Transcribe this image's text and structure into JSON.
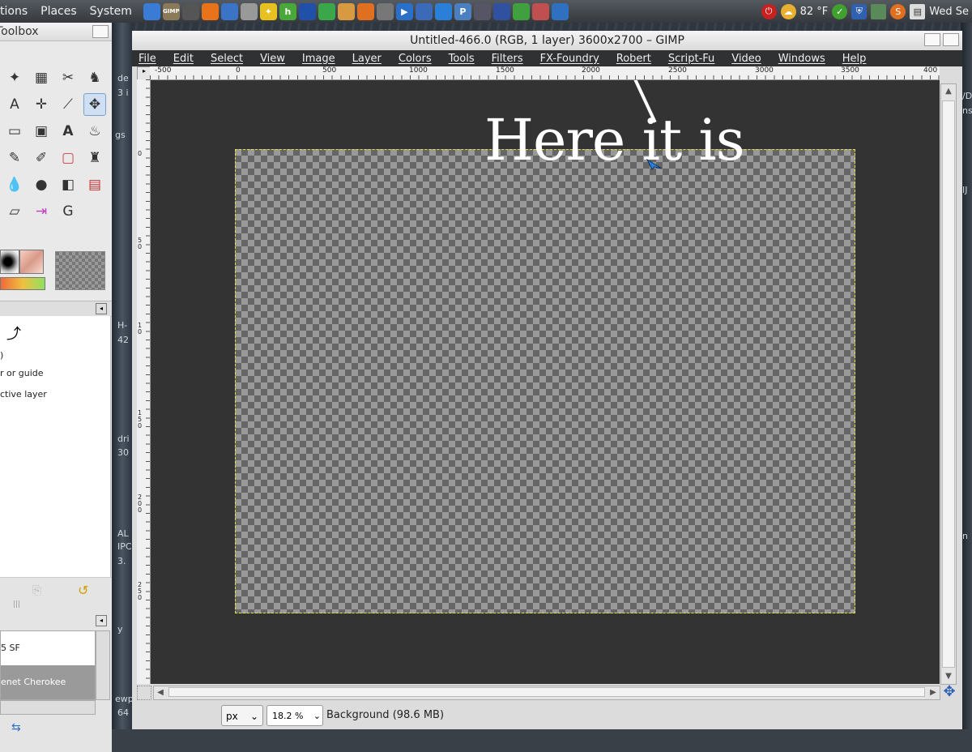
{
  "panel": {
    "menus": [
      "tions",
      "Places",
      "System"
    ],
    "launchers": [
      {
        "icon": "thunderbird-icon",
        "color": "#3a7bd5",
        "glyph": ""
      },
      {
        "icon": "gimp-icon",
        "color": "#8a7a5a",
        "glyph": "GIMP"
      },
      {
        "icon": "inkscape-icon",
        "color": "#555",
        "glyph": ""
      },
      {
        "icon": "firefox-icon",
        "color": "#e8731a",
        "glyph": ""
      },
      {
        "icon": "monitor-icon",
        "color": "#3b73c6",
        "glyph": ""
      },
      {
        "icon": "file-manager-icon",
        "color": "#999",
        "glyph": ""
      },
      {
        "icon": "star-icon",
        "color": "#e8c020",
        "glyph": "✦"
      },
      {
        "icon": "h-app-icon",
        "color": "#4aa83a",
        "glyph": "h"
      },
      {
        "icon": "book-icon",
        "color": "#2050a8",
        "glyph": ""
      },
      {
        "icon": "chrome-icon",
        "color": "#3aa84a",
        "glyph": ""
      },
      {
        "icon": "wallet-icon",
        "color": "#d89a40",
        "glyph": ""
      },
      {
        "icon": "blender-icon",
        "color": "#e07020",
        "glyph": ""
      },
      {
        "icon": "film-icon",
        "color": "#777",
        "glyph": ""
      },
      {
        "icon": "media-player-icon",
        "color": "#2a70c8",
        "glyph": "▶"
      },
      {
        "icon": "network-icon",
        "color": "#3a6ab8",
        "glyph": ""
      },
      {
        "icon": "teamviewer-icon",
        "color": "#2a80d8",
        "glyph": ""
      },
      {
        "icon": "pandora-icon",
        "color": "#4a80c0",
        "glyph": "P"
      },
      {
        "icon": "people-icon",
        "color": "#556",
        "glyph": ""
      },
      {
        "icon": "globe-icon",
        "color": "#3050a0",
        "glyph": ""
      },
      {
        "icon": "puzzle-icon",
        "color": "#40a040",
        "glyph": ""
      },
      {
        "icon": "document-icon",
        "color": "#c05050",
        "glyph": ""
      },
      {
        "icon": "drop-icon",
        "color": "#3070c0",
        "glyph": ""
      }
    ],
    "tray": {
      "temperature": "82 °F",
      "date": "Wed Se"
    }
  },
  "toolbox": {
    "title": "Toolbox",
    "options_lines": [
      ")",
      "r or guide",
      "ctive layer"
    ],
    "list_rows": [
      "5 SF",
      "enet Cherokee"
    ]
  },
  "window": {
    "title": "Untitled-466.0 (RGB, 1 layer) 3600x2700 – GIMP",
    "menus": [
      "File",
      "Edit",
      "Select",
      "View",
      "Image",
      "Layer",
      "Colors",
      "Tools",
      "Filters",
      "FX-Foundry",
      "Robert",
      "Script-Fu",
      "Video",
      "Windows",
      "Help"
    ],
    "ruler_labels": [
      "-500",
      "0",
      "500",
      "1000",
      "1500",
      "2000",
      "2500",
      "3000",
      "3500",
      "400"
    ],
    "vruler_labels": [
      "0",
      "5 0",
      "1 0",
      "1 5 0",
      "2 0 0",
      "2 5 0"
    ],
    "annotation": "Here it is",
    "status": {
      "unit": "px",
      "zoom": "18.2 %",
      "message": "Background (98.6 MB)"
    }
  },
  "desktop": {
    "fragments": [
      "de",
      "3 i",
      "gs",
      "H-",
      "42",
      "dri",
      "30",
      "AL",
      "IPC",
      "3.",
      "y",
      "ewp",
      "64",
      "/D",
      "ns",
      "IJ",
      "n"
    ]
  }
}
